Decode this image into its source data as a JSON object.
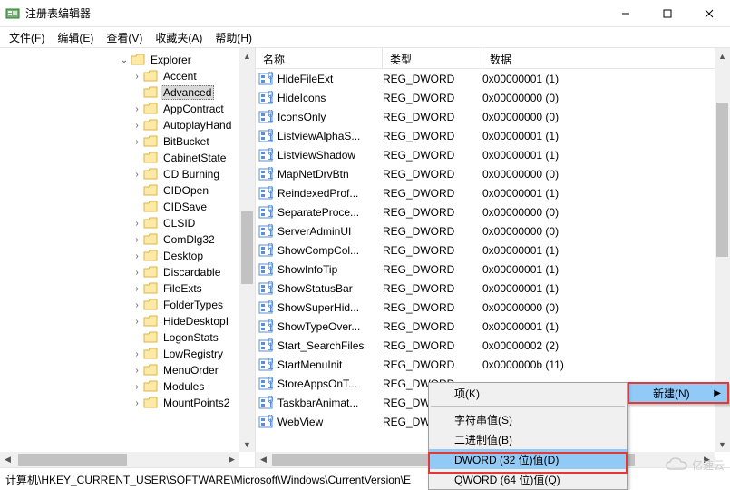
{
  "window": {
    "title": "注册表编辑器"
  },
  "menu": {
    "file": "文件(F)",
    "edit": "编辑(E)",
    "view": "查看(V)",
    "favorites": "收藏夹(A)",
    "help": "帮助(H)"
  },
  "tree": {
    "root": "Explorer",
    "nodes": [
      {
        "label": "Accent",
        "exp": ">"
      },
      {
        "label": "Advanced",
        "exp": "",
        "sel": true
      },
      {
        "label": "AppContract",
        "exp": ">"
      },
      {
        "label": "AutoplayHand",
        "exp": ">"
      },
      {
        "label": "BitBucket",
        "exp": ">"
      },
      {
        "label": "CabinetState",
        "exp": ""
      },
      {
        "label": "CD Burning",
        "exp": ">"
      },
      {
        "label": "CIDOpen",
        "exp": ""
      },
      {
        "label": "CIDSave",
        "exp": ""
      },
      {
        "label": "CLSID",
        "exp": ">"
      },
      {
        "label": "ComDlg32",
        "exp": ">"
      },
      {
        "label": "Desktop",
        "exp": ">"
      },
      {
        "label": "Discardable",
        "exp": ">"
      },
      {
        "label": "FileExts",
        "exp": ">"
      },
      {
        "label": "FolderTypes",
        "exp": ">"
      },
      {
        "label": "HideDesktopI",
        "exp": ">"
      },
      {
        "label": "LogonStats",
        "exp": ""
      },
      {
        "label": "LowRegistry",
        "exp": ">"
      },
      {
        "label": "MenuOrder",
        "exp": ">"
      },
      {
        "label": "Modules",
        "exp": ">"
      },
      {
        "label": "MountPoints2",
        "exp": ">"
      }
    ]
  },
  "list": {
    "headers": {
      "name": "名称",
      "type": "类型",
      "data": "数据"
    },
    "col_widths": {
      "name": 140,
      "type": 110,
      "data": 250
    },
    "rows": [
      {
        "name": "HideFileExt",
        "type": "REG_DWORD",
        "data": "0x00000001 (1)"
      },
      {
        "name": "HideIcons",
        "type": "REG_DWORD",
        "data": "0x00000000 (0)"
      },
      {
        "name": "IconsOnly",
        "type": "REG_DWORD",
        "data": "0x00000000 (0)"
      },
      {
        "name": "ListviewAlphaS...",
        "type": "REG_DWORD",
        "data": "0x00000001 (1)"
      },
      {
        "name": "ListviewShadow",
        "type": "REG_DWORD",
        "data": "0x00000001 (1)"
      },
      {
        "name": "MapNetDrvBtn",
        "type": "REG_DWORD",
        "data": "0x00000000 (0)"
      },
      {
        "name": "ReindexedProf...",
        "type": "REG_DWORD",
        "data": "0x00000001 (1)"
      },
      {
        "name": "SeparateProce...",
        "type": "REG_DWORD",
        "data": "0x00000000 (0)"
      },
      {
        "name": "ServerAdminUI",
        "type": "REG_DWORD",
        "data": "0x00000000 (0)"
      },
      {
        "name": "ShowCompCol...",
        "type": "REG_DWORD",
        "data": "0x00000001 (1)"
      },
      {
        "name": "ShowInfoTip",
        "type": "REG_DWORD",
        "data": "0x00000001 (1)"
      },
      {
        "name": "ShowStatusBar",
        "type": "REG_DWORD",
        "data": "0x00000001 (1)"
      },
      {
        "name": "ShowSuperHid...",
        "type": "REG_DWORD",
        "data": "0x00000000 (0)"
      },
      {
        "name": "ShowTypeOver...",
        "type": "REG_DWORD",
        "data": "0x00000001 (1)"
      },
      {
        "name": "Start_SearchFiles",
        "type": "REG_DWORD",
        "data": "0x00000002 (2)"
      },
      {
        "name": "StartMenuInit",
        "type": "REG_DWORD",
        "data": "0x0000000b (11)"
      },
      {
        "name": "StoreAppsOnT...",
        "type": "REG_DWORD",
        "data": ""
      },
      {
        "name": "TaskbarAnimat...",
        "type": "REG_DWORD",
        "data": ""
      },
      {
        "name": "WebView",
        "type": "REG_DWORD",
        "data": ""
      }
    ]
  },
  "context": {
    "new": "新建(N)",
    "sub": {
      "key": "项(K)",
      "string": "字符串值(S)",
      "binary": "二进制值(B)",
      "dword": "DWORD (32 位)值(D)",
      "qword": "QWORD (64 位)值(Q)"
    }
  },
  "status": {
    "path": "计算机\\HKEY_CURRENT_USER\\SOFTWARE\\Microsoft\\Windows\\CurrentVersion\\E"
  },
  "watermark": "亿速云"
}
